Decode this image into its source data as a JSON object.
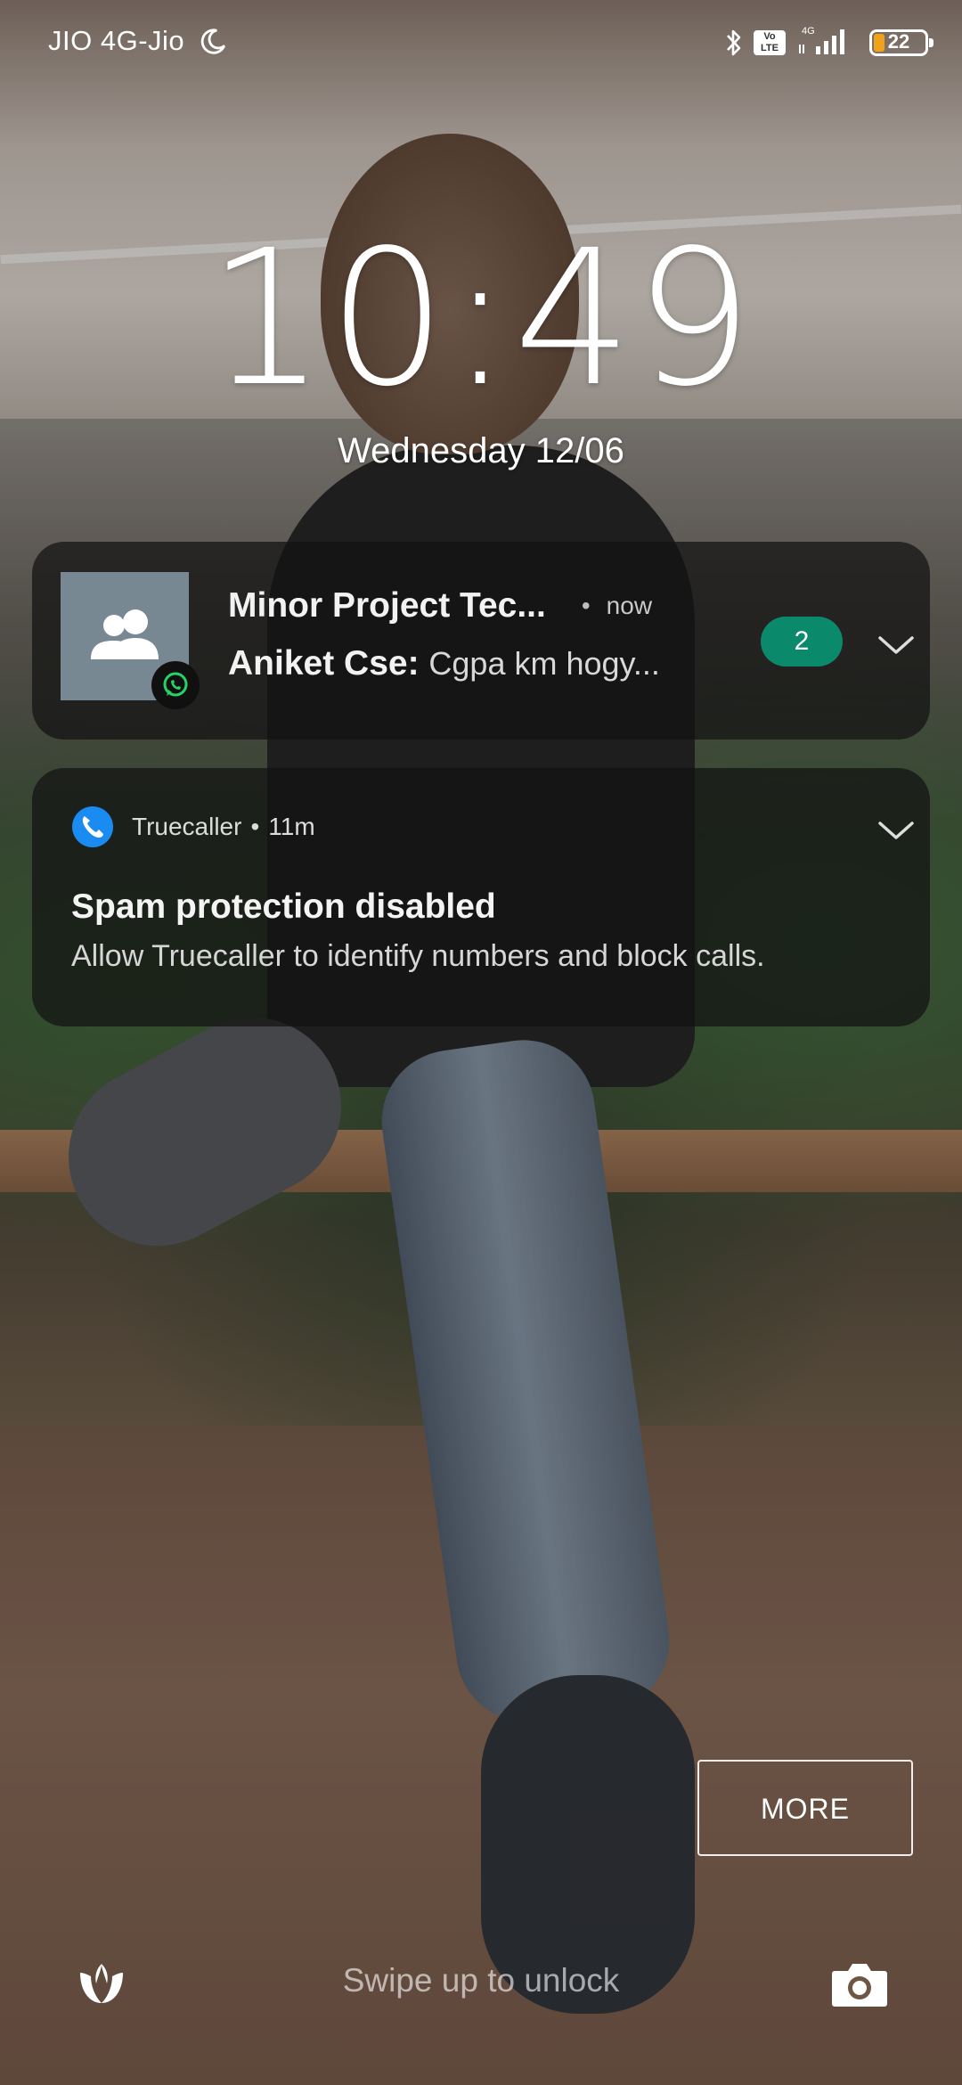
{
  "status_bar": {
    "carrier": "JIO 4G-Jio",
    "moon_icon": "moon-icon",
    "bluetooth_icon": "bluetooth-icon",
    "volte_label": "Vo\nLTE",
    "network_label": "4G",
    "battery_level": "22",
    "battery_color": "#f0a21a"
  },
  "lockscreen": {
    "time": "10:49",
    "date": "Wednesday 12/06"
  },
  "notifications": [
    {
      "app_icon": "whatsapp-icon",
      "avatar_icon": "group-avatar-icon",
      "title": "Minor Project Tec...",
      "separator": "•",
      "time": "now",
      "sender": "Aniket Cse:",
      "message": "Cgpa km hogy...",
      "count": "2",
      "count_color": "#0b8a6b"
    },
    {
      "app_icon": "truecaller-icon",
      "app_name": "Truecaller",
      "separator": "•",
      "time": "11m",
      "title": "Spam protection disabled",
      "body": "Allow Truecaller to identify numbers and block calls."
    }
  ],
  "bottom": {
    "more_label": "MORE",
    "swipe_hint": "Swipe up to unlock",
    "left_shortcut_icon": "tulip-icon",
    "right_shortcut_icon": "camera-icon"
  }
}
